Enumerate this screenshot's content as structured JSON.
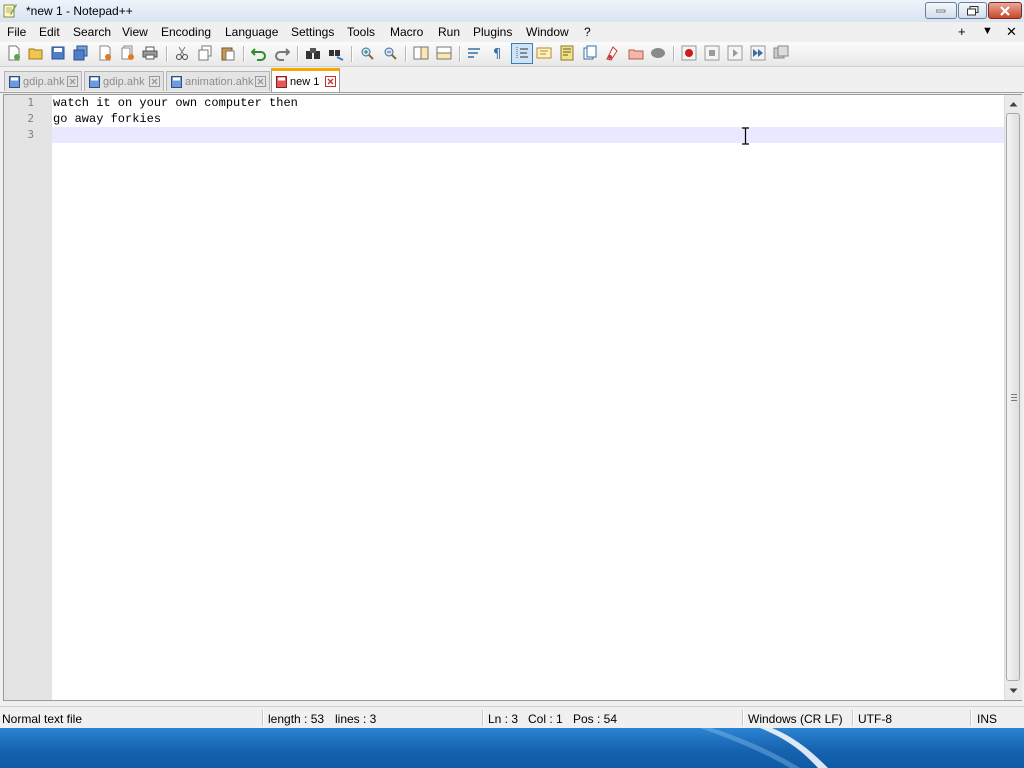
{
  "window": {
    "title": "*new 1 - Notepad++"
  },
  "menu": {
    "items": [
      "File",
      "Edit",
      "Search",
      "View",
      "Encoding",
      "Language",
      "Settings",
      "Tools",
      "Macro",
      "Run",
      "Plugins",
      "Window",
      "?"
    ],
    "right_controls": [
      "+",
      "▼",
      "✕"
    ]
  },
  "tabs": [
    {
      "label": "gdip.ahk",
      "active": false
    },
    {
      "label": "gdip.ahk",
      "active": false
    },
    {
      "label": "animation.ahk",
      "active": false
    },
    {
      "label": "new 1",
      "active": true
    }
  ],
  "editor": {
    "lines": [
      {
        "num": "1",
        "text": "watch it on your own computer then"
      },
      {
        "num": "2",
        "text": "go away forkies"
      },
      {
        "num": "3",
        "text": ""
      }
    ]
  },
  "status": {
    "file_type": "Normal text file",
    "length": "length : 53",
    "lines": "lines : 3",
    "ln": "Ln : 3",
    "col": "Col : 1",
    "pos": "Pos : 54",
    "eol": "Windows (CR LF)",
    "encoding": "UTF-8",
    "mode": "INS"
  },
  "colors": {
    "accent_tab": "#f7a600",
    "caret_line": "#e8e8ff",
    "gutter": "#e4e4e4",
    "close_button": "#c8462b"
  },
  "icons": {
    "toolbar": [
      "new-file-icon",
      "open-file-icon",
      "save-icon",
      "save-all-icon",
      "close-icon",
      "close-all-icon",
      "print-icon",
      "cut-icon",
      "copy-icon",
      "paste-icon",
      "undo-icon",
      "redo-icon",
      "find-icon",
      "replace-icon",
      "zoom-in-icon",
      "zoom-out-icon",
      "sync-vertical-icon",
      "sync-horizontal-icon",
      "word-wrap-icon",
      "show-all-chars-icon",
      "indent-guide-icon",
      "user-defined-language-icon",
      "doc-map-icon",
      "function-list-icon",
      "folder-as-workspace-icon",
      "monitoring-icon",
      "record-macro-icon",
      "stop-recording-icon",
      "playback-macro-icon",
      "run-macro-multiple-icon",
      "save-macro-icon"
    ]
  }
}
